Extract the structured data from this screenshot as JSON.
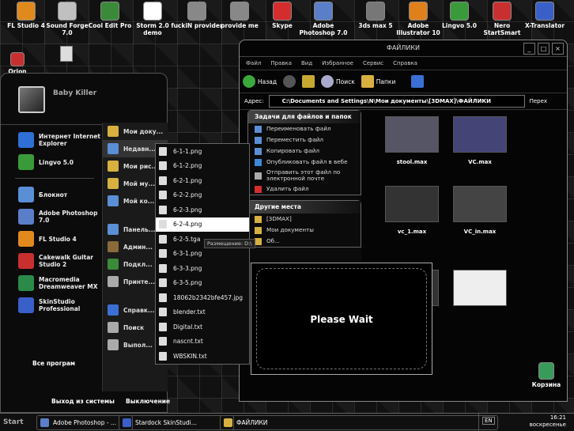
{
  "desktop": {
    "icons": [
      {
        "label": "FL Studio 4",
        "color": "#e08a1e"
      },
      {
        "label": "Sound Forge 7.0",
        "color": "#c0c0c0"
      },
      {
        "label": "Cool Edit Pro",
        "color": "#3a8a3a"
      },
      {
        "label": "Storm 2.0 demo",
        "color": "#ffffff"
      },
      {
        "label": "fuckiN provider",
        "color": "#888888"
      },
      {
        "label": "provide me",
        "color": "#888888"
      },
      {
        "label": "Skype",
        "color": "#d42d2d"
      },
      {
        "label": "Adobe Photoshop 7.0",
        "color": "#5a7fc8"
      },
      {
        "label": "3ds max 5",
        "color": "#777777"
      },
      {
        "label": "Adobe Illustrator 10",
        "color": "#e0801a"
      },
      {
        "label": "Lingvo 5.0",
        "color": "#3a9a3a"
      },
      {
        "label": "Nero StartSmart",
        "color": "#c83030"
      },
      {
        "label": "X-Translator",
        "color": "#3a5fc8"
      }
    ],
    "orion_label": "Orion Platinum",
    "recycle_label": "Корзина"
  },
  "start_menu": {
    "username": "Baby Killer",
    "pinned": [
      {
        "label": "Интернет Internet Explorer",
        "color": "#2f6fd6"
      },
      {
        "label": "Lingvo 5.0",
        "color": "#3a9a3a"
      }
    ],
    "recent": [
      {
        "label": "Блокнот",
        "color": "#5a8fd6"
      },
      {
        "label": "Adobe Photoshop 7.0",
        "color": "#5a7fc8"
      },
      {
        "label": "FL Studio 4",
        "color": "#e08a1e"
      },
      {
        "label": "Cakewalk Guitar Studio 2",
        "color": "#c83030"
      },
      {
        "label": "Macromedia Dreamweaver MX",
        "color": "#2a8a4a"
      },
      {
        "label": "SkinStudio Professional",
        "color": "#3a5fc8"
      }
    ],
    "all_programs": "Все програм",
    "right_items": [
      {
        "label": "Мои доку...",
        "color": "#d8b040"
      },
      {
        "label": "Недавн...",
        "color": "#5a8fd6"
      },
      {
        "label": "Мои рис...",
        "color": "#d8b040"
      },
      {
        "label": "Мой му...",
        "color": "#d8b040"
      },
      {
        "label": "Мой ко...",
        "color": "#5a8fd6"
      },
      {
        "label": "Панель...",
        "color": "#5a8fd6"
      },
      {
        "label": "Админ...",
        "color": "#8a6a3a"
      },
      {
        "label": "Подкл...",
        "color": "#3a8a3a"
      },
      {
        "label": "Принте...",
        "color": "#aaaaaa"
      },
      {
        "label": "Справк...",
        "color": "#3a6fd6"
      },
      {
        "label": "Поиск",
        "color": "#aaaaaa"
      },
      {
        "label": "Выпол...",
        "color": "#aaaaaa"
      }
    ],
    "logout": "Выход из системы",
    "shutdown": "Выключение"
  },
  "recent_submenu": {
    "items": [
      "6-1-1.png",
      "6-1-2.png",
      "6-2-1.png",
      "6-2-2.png",
      "6-2-3.png",
      "6-2-4.png",
      "6-2-5.tga",
      "6-3-1.png",
      "6-3-3.png",
      "6-3-5.png",
      "18062b2342bfe457.jpg",
      "blender.txt",
      "Digital.txt",
      "nascnt.txt",
      "WBSKIN.txt"
    ],
    "selected_index": 5,
    "tooltip": "Размещение: D:\\"
  },
  "explorer": {
    "title": "ФАЙЛИКИ",
    "menu": [
      "Файл",
      "Правка",
      "Вид",
      "Избранное",
      "Сервис",
      "Справка"
    ],
    "toolbar": {
      "back": "Назад",
      "search": "Поиск",
      "folders": "Папки"
    },
    "address_label": "Адрес:",
    "address": "C:\\Documents and Settings\\N\\Мои документы\\[3DMAX]\\ФАЙЛИКИ",
    "go": "Перех",
    "tasks_title": "Задачи для файлов и папок",
    "tasks": [
      {
        "label": "Переименовать файл",
        "color": "#5a8fd6"
      },
      {
        "label": "Переместить файл",
        "color": "#5a8fd6"
      },
      {
        "label": "Копировать файл",
        "color": "#5a8fd6"
      },
      {
        "label": "Опубликовать файл в вебе",
        "color": "#3a8ad6"
      },
      {
        "label": "Отправить этот файл по электронной почте",
        "color": "#aaaaaa"
      },
      {
        "label": "Удалить файл",
        "color": "#d42d2d"
      }
    ],
    "places_title": "Другие места",
    "places": [
      "[3DMAX]",
      "Мои документы",
      "Об..."
    ],
    "files": [
      {
        "name": "stool.max",
        "color": "#556"
      },
      {
        "name": "VC.max",
        "color": "#447"
      },
      {
        "name": "vc_1.max",
        "color": "#333"
      },
      {
        "name": "VC_in.max",
        "color": "#444"
      },
      {
        "name": "",
        "color": "#333"
      },
      {
        "name": "",
        "color": "#eee"
      }
    ]
  },
  "wait_dialog": {
    "message": "Please Wait"
  },
  "taskbar": {
    "start": "Start",
    "tasks": [
      {
        "label": "Adobe Photoshop - ...",
        "color": "#5a7fc8"
      },
      {
        "label": "Stardock SkinStudi...",
        "color": "#3a5fc8"
      },
      {
        "label": "ФАЙЛИКИ",
        "color": "#d8b040"
      }
    ],
    "lang": "EN",
    "time": "16:21",
    "day": "воскресенье"
  }
}
